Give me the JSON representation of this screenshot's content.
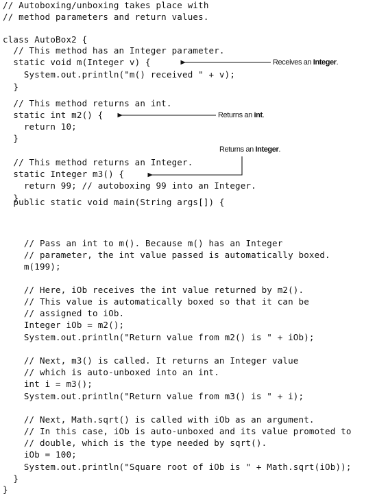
{
  "code_lines": [
    "// Autoboxing/unboxing takes place with",
    "// method parameters and return values.",
    "",
    "class AutoBox2 {",
    "  // This method has an Integer parameter.",
    "  static void m(Integer v) {",
    "    System.out.println(\"m() received \" + v);",
    "  }",
    "",
    "  // This method returns an int.",
    "  static int m2() {",
    "    return 10;",
    "  }",
    "",
    "",
    "  // This method returns an Integer.",
    "  static Integer m3() {",
    "    return 99; // autoboxing 99 into an Integer.",
    "  }",
    "",
    "  public static void main(String args[]) {",
    "",
    "    // Pass an int to m(). Because m() has an Integer",
    "    // parameter, the int value passed is automatically boxed.",
    "    m(199);",
    "",
    "    // Here, iOb receives the int value returned by m2().",
    "    // This value is automatically boxed so that it can be",
    "    // assigned to iOb.",
    "    Integer iOb = m2();",
    "    System.out.println(\"Return value from m2() is \" + iOb);",
    "",
    "    // Next, m3() is called. It returns an Integer value",
    "    // which is auto-unboxed into an int.",
    "    int i = m3();",
    "    System.out.println(\"Return value from m3() is \" + i);",
    "",
    "    // Next, Math.sqrt() is called with iOb as an argument.",
    "    // In this case, iOb is auto-unboxed and its value promoted to",
    "    // double, which is the type needed by sqrt().",
    "    iOb = 100;",
    "    System.out.println(\"Square root of iOb is \" + Math.sqrt(iOb));",
    "  }",
    "}"
  ],
  "callouts": {
    "receives_integer": {
      "prefix": "Receives an ",
      "strong": "Integer",
      "suffix": "."
    },
    "returns_int": {
      "prefix": "Returns an ",
      "strong": "int",
      "suffix": "."
    },
    "returns_integer": {
      "prefix": "Returns an ",
      "strong": "Integer",
      "suffix": "."
    }
  }
}
